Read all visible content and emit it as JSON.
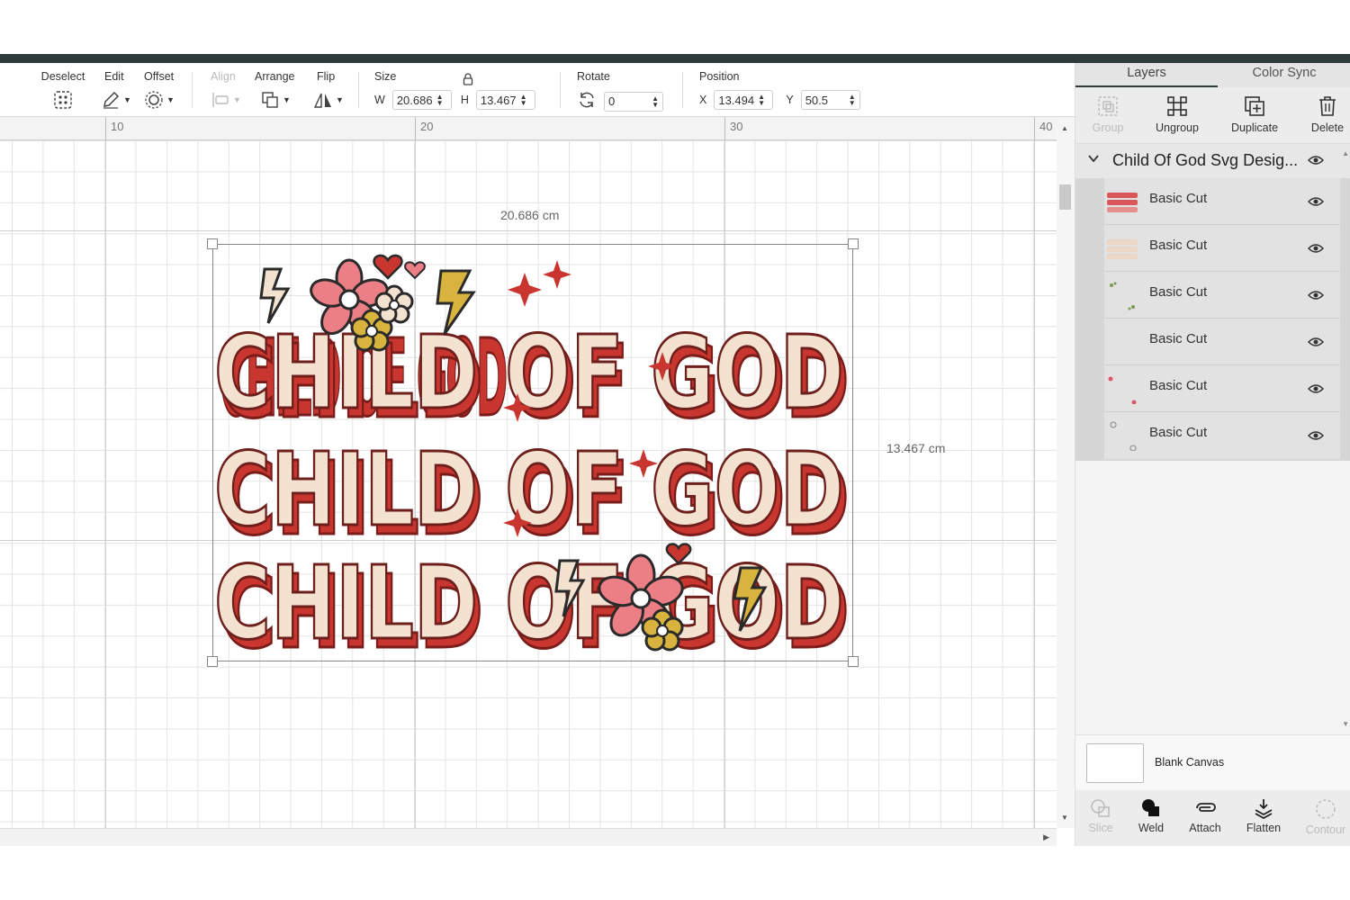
{
  "toolbar": {
    "deselect_label": "Deselect",
    "edit_label": "Edit",
    "offset_label": "Offset",
    "align_label": "Align",
    "arrange_label": "Arrange",
    "flip_label": "Flip",
    "size_label": "Size",
    "width_letter": "W",
    "width_value": "20.686",
    "height_letter": "H",
    "height_value": "13.467",
    "rotate_label": "Rotate",
    "rotate_value": "0",
    "position_label": "Position",
    "x_letter": "X",
    "x_value": "13.494",
    "y_letter": "Y",
    "y_value": "50.5"
  },
  "ruler": {
    "ticks": [
      "10",
      "20",
      "30",
      "40"
    ]
  },
  "canvas": {
    "width_dimension": "20.686 cm",
    "height_dimension": "13.467 cm",
    "design_lines": [
      "CHILD OF GOD",
      "CHILD OF GOD",
      "CHILD OF GOD"
    ]
  },
  "panel": {
    "tabs": [
      "Layers",
      "Color Sync"
    ],
    "layer_tools": {
      "group": "Group",
      "ungroup": "Ungroup",
      "duplicate": "Duplicate",
      "delete": "Delete"
    },
    "group_title": "Child Of God Svg Desig...",
    "layers": [
      {
        "name": "Basic Cut",
        "thumb": "red-text"
      },
      {
        "name": "Basic Cut",
        "thumb": "cream-text"
      },
      {
        "name": "Basic Cut",
        "thumb": "green-dots"
      },
      {
        "name": "Basic Cut",
        "thumb": "empty"
      },
      {
        "name": "Basic Cut",
        "thumb": "pink-dots"
      },
      {
        "name": "Basic Cut",
        "thumb": "grey-dots"
      }
    ],
    "blank_canvas_label": "Blank Canvas",
    "bottom_tools": {
      "slice": "Slice",
      "weld": "Weld",
      "attach": "Attach",
      "flatten": "Flatten",
      "contour": "Contour"
    }
  },
  "colors": {
    "accent_dark": "#2f3b3a",
    "design_red": "#c8362f",
    "design_cream": "#f3e2d0",
    "design_pink": "#ec7f86",
    "design_gold": "#d8b43e"
  }
}
